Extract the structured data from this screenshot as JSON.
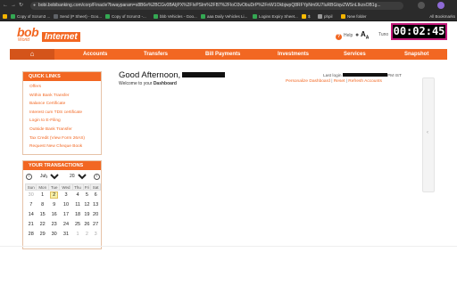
{
  "browser": {
    "url": "bobi.bobibanking.com/corp/Finacle?bwayparam=s8B6e%2BCGv0BAIjPX%2FIvPSlm%2FB7%2FloO3vObuDrP%2FnW1OkbjwpQ8RFYpNm9U7IuRBGtqvZWSnLIkzsOB1g...",
    "back_icon": "←",
    "forward_icon": "→",
    "reload_icon": "↻",
    "bookmarks": [
      {
        "label": "",
        "color": "#f4b400"
      },
      {
        "label": "Copy of Scrum3 ...",
        "color": "#34a853"
      },
      {
        "label": "Send (P Sheet) - Goo...",
        "color": "#5f6368"
      },
      {
        "label": "Copy of Scrum3 -...",
        "color": "#34a853"
      },
      {
        "label": "bbb Vehicles - Goo...",
        "color": "#34a853"
      },
      {
        "label": "aaa Daily Vehicles Li...",
        "color": "#34a853"
      },
      {
        "label": "Logins Expiry Sheet...",
        "color": "#34a853"
      },
      {
        "label": "$",
        "color": "#fbbc04"
      },
      {
        "label": "phpil",
        "color": "#999999"
      },
      {
        "label": "New folder",
        "color": "#f4b400"
      }
    ],
    "all_bookmarks": "All Bookmarks"
  },
  "timer": "00:02:45",
  "header": {
    "logo_bob": "bob",
    "logo_world": "World",
    "logo_internet": "Internet",
    "help": "Help",
    "text_size": "A",
    "text_size_sub": "A",
    "user_fragment": "Tuno"
  },
  "nav": {
    "home_icon": "⌂",
    "items": [
      "Accounts",
      "Transfers",
      "Bill Payments",
      "Investments",
      "Services",
      "Snapshot"
    ]
  },
  "quick_links": {
    "title": "Quick Links",
    "items": [
      "Offers",
      "Within Bank Transfer",
      "Balance Certificate",
      "Interest cum TDS certificate",
      "Login to E-Filing",
      "Outside Bank Transfer",
      "Tax Credit (View Form 26AS)",
      "Request New Cheque Book"
    ]
  },
  "transactions": {
    "title": "Your Transactions",
    "month": "July",
    "year": "2024",
    "weekdays": [
      "Sun",
      "Mon",
      "Tue",
      "Wed",
      "Thu",
      "Fri",
      "Sat"
    ],
    "weeks": [
      [
        "30",
        "1",
        "2",
        "3",
        "4",
        "5",
        "6"
      ],
      [
        "7",
        "8",
        "9",
        "10",
        "11",
        "12",
        "13"
      ],
      [
        "14",
        "15",
        "16",
        "17",
        "18",
        "19",
        "20"
      ],
      [
        "21",
        "22",
        "23",
        "24",
        "25",
        "26",
        "27"
      ],
      [
        "28",
        "29",
        "30",
        "31",
        "1",
        "2",
        "3"
      ]
    ],
    "today": "2"
  },
  "main": {
    "greeting": "Good Afternoon,",
    "welcome_prefix": "Welcome to your",
    "welcome_bold": "Dashboard",
    "last_login_label": "Last login",
    "last_login_suffix": "PM IST",
    "links": [
      "Personalize Dashboard",
      "Reset",
      "Refresh Accounts"
    ]
  },
  "side_tab_icon": "‹",
  "colors": {
    "brand": "#f26722",
    "brand_dark": "#d4541a",
    "timer_border": "#c2187a"
  }
}
